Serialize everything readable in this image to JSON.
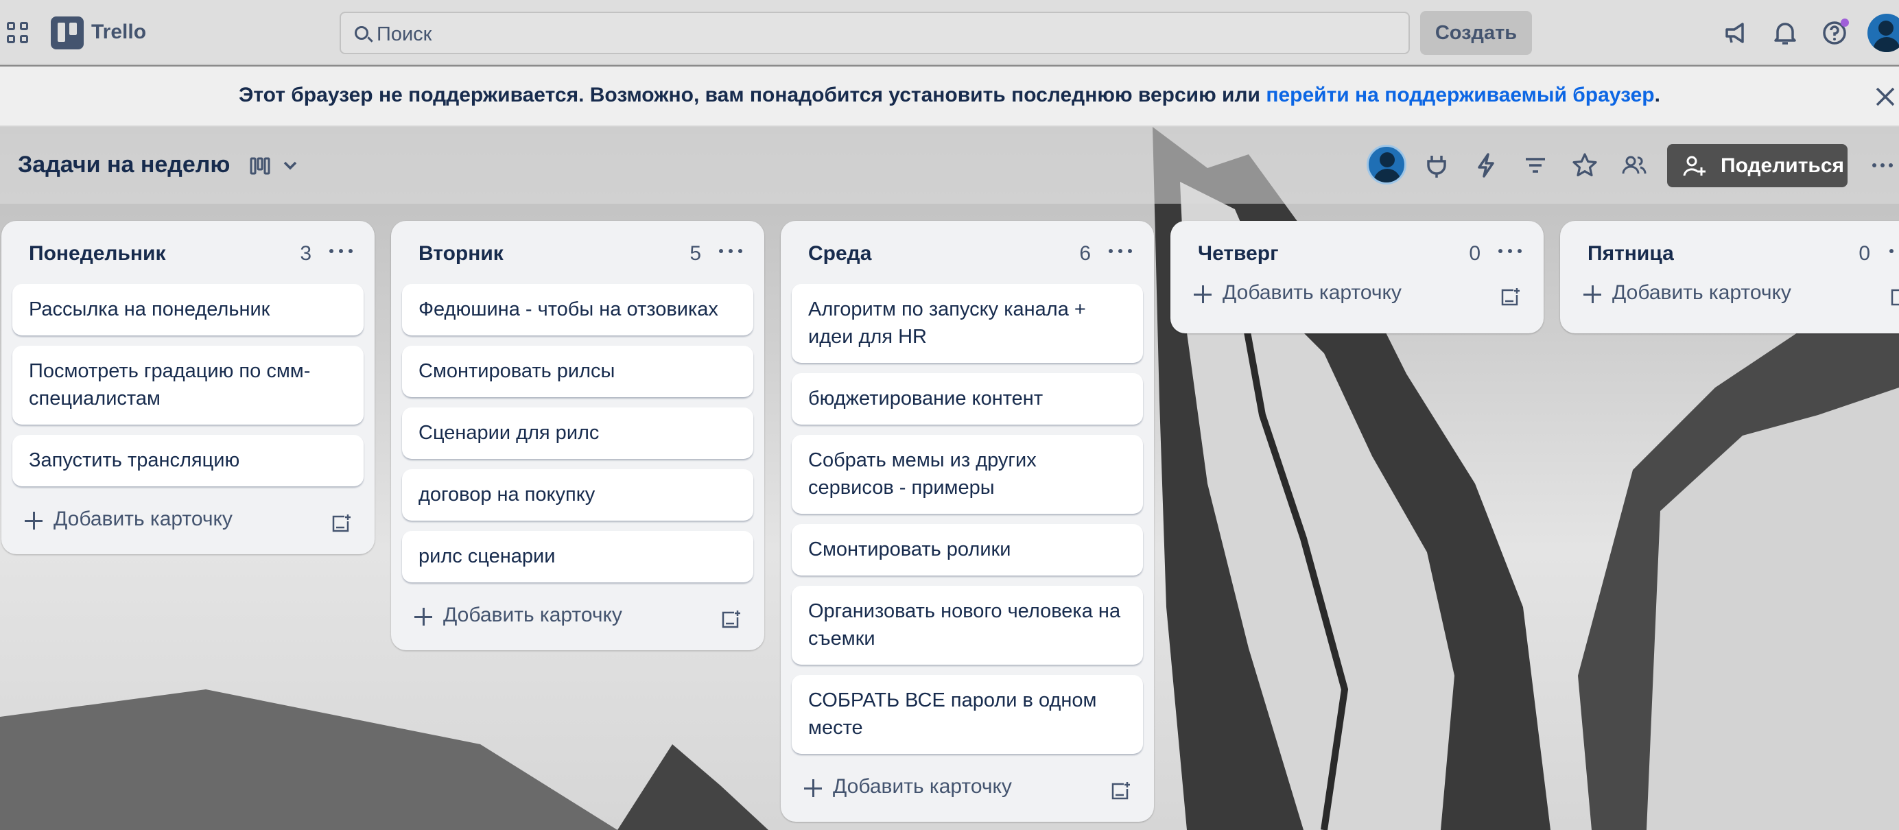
{
  "app": {
    "brand": "Trello"
  },
  "topnav": {
    "search_placeholder": "Поиск",
    "create_label": "Создать",
    "icons": [
      "apps-grid-icon",
      "megaphone-icon",
      "bell-icon",
      "help-icon",
      "avatar"
    ]
  },
  "banner": {
    "text": "Этот браузер не поддерживается. Возможно, вам понадобится установить последнюю версию или ",
    "link": "перейти на поддерживаемый браузер",
    "end": "."
  },
  "board": {
    "title": "Задачи на неделю",
    "share_label": "Поделиться"
  },
  "colors": {
    "accent": "#0c66e4",
    "share_bg": "#505050",
    "list_bg": "#f1f2f4"
  },
  "add_card_label": "Добавить карточку",
  "lists": [
    {
      "name": "Понедельник",
      "count": "3",
      "cards": [
        "Рассылка на понедельник",
        "Посмотреть градацию по смм-специалистам",
        "Запустить трансляцию"
      ]
    },
    {
      "name": "Вторник",
      "count": "5",
      "cards": [
        "Федюшина - чтобы на отзовиках",
        "Смонтировать рилсы",
        "Сценарии для рилс",
        "договор на покупку",
        "рилс сценарии"
      ]
    },
    {
      "name": "Среда",
      "count": "6",
      "cards": [
        "Алгоритм по запуску канала + идеи для HR",
        "бюджетирование контент",
        "Собрать мемы из других сервисов - примеры",
        "Смонтировать ролики",
        "Организовать нового человека на съемки",
        "СОБРАТЬ ВСЕ пароли в одном месте"
      ]
    },
    {
      "name": "Четверг",
      "count": "0",
      "cards": []
    },
    {
      "name": "Пятница",
      "count": "0",
      "cards": []
    }
  ]
}
